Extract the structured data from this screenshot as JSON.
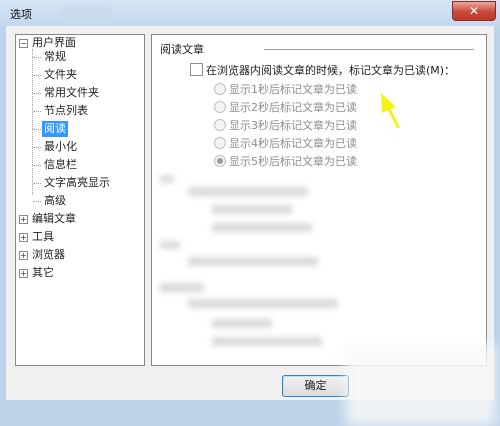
{
  "window": {
    "title": "选项",
    "close_glyph": "✕"
  },
  "tree": {
    "items": [
      {
        "label": "用户界面",
        "expander": "−"
      },
      {
        "label": "常规"
      },
      {
        "label": "文件夹"
      },
      {
        "label": "常用文件夹"
      },
      {
        "label": "节点列表"
      },
      {
        "label": "阅读",
        "selected": true
      },
      {
        "label": "最小化"
      },
      {
        "label": "信息栏"
      },
      {
        "label": "文字高亮显示"
      },
      {
        "label": "高级"
      },
      {
        "label": "编辑文章",
        "expander": "+"
      },
      {
        "label": "工具",
        "expander": "+"
      },
      {
        "label": "浏览器",
        "expander": "+"
      },
      {
        "label": "其它",
        "expander": "+"
      }
    ]
  },
  "panel": {
    "section_title": "阅读文章",
    "mark_read_checkbox": {
      "label": "在浏览器内阅读文章的时候，标记文章为已读(M)：",
      "checked": false
    },
    "radio_options": [
      {
        "label": "显示1秒后标记文章为已读",
        "checked": false
      },
      {
        "label": "显示2秒后标记文章为已读",
        "checked": false
      },
      {
        "label": "显示3秒后标记文章为已读",
        "checked": false
      },
      {
        "label": "显示4秒后标记文章为已读",
        "checked": false
      },
      {
        "label": "显示5秒后标记文章为已读",
        "checked": true
      }
    ]
  },
  "buttons": {
    "ok_label": "确定"
  },
  "colors": {
    "selection": "#3399ff",
    "annotation_arrow": "#f5f21a"
  }
}
